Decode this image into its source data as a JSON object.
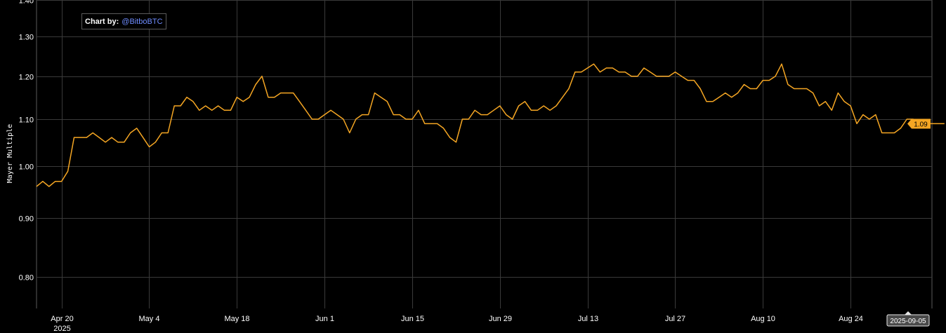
{
  "credit": {
    "label": "Chart by:",
    "handle": "@BitboBTC"
  },
  "chart_data": {
    "type": "line",
    "ylabel": "Mayer Multiple",
    "yscale": "log",
    "ylim": [
      0.75,
      1.4
    ],
    "yticks": [
      0.8,
      0.9,
      1.0,
      1.1,
      1.2,
      1.3,
      1.4
    ],
    "ytick_labels": [
      "0.80",
      "0.90",
      "1.00",
      "1.10",
      "1.20",
      "1.30",
      "1.40"
    ],
    "x_range": [
      "2025-04-16",
      "2025-09-06"
    ],
    "xticks": [
      "2025-04-20",
      "2025-05-04",
      "2025-05-18",
      "2025-06-01",
      "2025-06-15",
      "2025-06-29",
      "2025-07-13",
      "2025-07-27",
      "2025-08-10",
      "2025-08-24"
    ],
    "xtick_labels": [
      "Apr 20",
      "May 4",
      "May 18",
      "Jun 1",
      "Jun 15",
      "Jun 29",
      "Jul 13",
      "Jul 27",
      "Aug 10",
      "Aug 24"
    ],
    "xtick_sublabels": [
      "2025",
      "",
      "",
      "",
      "",
      "",
      "",
      "",
      "",
      ""
    ],
    "grid": true,
    "line_color": "#f5a623",
    "last_value_label": "1.09",
    "cursor_date_label": "2025-09-05",
    "series": [
      {
        "x_start": "2025-04-16",
        "step_days": 1,
        "values": [
          0.96,
          0.97,
          0.96,
          0.97,
          0.97,
          0.99,
          1.06,
          1.06,
          1.06,
          1.07,
          1.06,
          1.05,
          1.06,
          1.05,
          1.05,
          1.07,
          1.08,
          1.06,
          1.04,
          1.05,
          1.07,
          1.07,
          1.13,
          1.13,
          1.15,
          1.14,
          1.12,
          1.13,
          1.12,
          1.13,
          1.12,
          1.12,
          1.15,
          1.14,
          1.15,
          1.18,
          1.2,
          1.15,
          1.15,
          1.16,
          1.16,
          1.16,
          1.14,
          1.12,
          1.1,
          1.1,
          1.11,
          1.12,
          1.11,
          1.1,
          1.07,
          1.1,
          1.11,
          1.11,
          1.16,
          1.15,
          1.14,
          1.11,
          1.11,
          1.1,
          1.1,
          1.12,
          1.09,
          1.09,
          1.09,
          1.08,
          1.06,
          1.05,
          1.1,
          1.1,
          1.12,
          1.11,
          1.11,
          1.12,
          1.13,
          1.11,
          1.1,
          1.13,
          1.14,
          1.12,
          1.12,
          1.13,
          1.12,
          1.13,
          1.15,
          1.17,
          1.21,
          1.21,
          1.22,
          1.23,
          1.21,
          1.22,
          1.22,
          1.21,
          1.21,
          1.2,
          1.2,
          1.22,
          1.21,
          1.2,
          1.2,
          1.2,
          1.21,
          1.2,
          1.19,
          1.19,
          1.17,
          1.14,
          1.14,
          1.15,
          1.16,
          1.15,
          1.16,
          1.18,
          1.17,
          1.17,
          1.19,
          1.19,
          1.2,
          1.23,
          1.18,
          1.17,
          1.17,
          1.17,
          1.16,
          1.13,
          1.14,
          1.12,
          1.16,
          1.14,
          1.13,
          1.09,
          1.11,
          1.1,
          1.11,
          1.07,
          1.07,
          1.07,
          1.08,
          1.1,
          1.1,
          1.09,
          1.09,
          1.09,
          1.09,
          1.09
        ]
      }
    ]
  }
}
